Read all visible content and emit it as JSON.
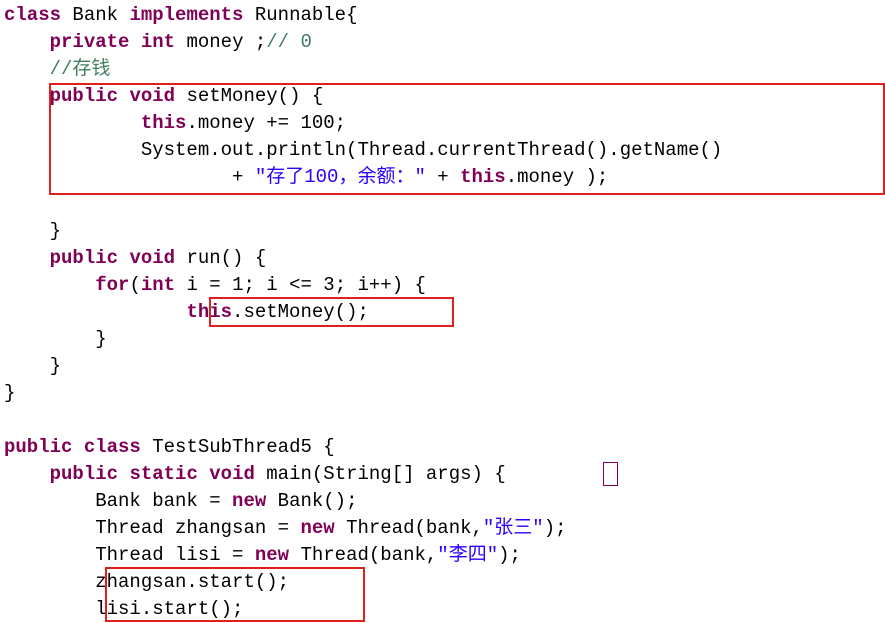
{
  "lines": [
    [
      {
        "t": "class",
        "k": "kw"
      },
      {
        "t": " Bank ",
        "k": "plain"
      },
      {
        "t": "implements",
        "k": "kw"
      },
      {
        "t": " Runnable{",
        "k": "plain"
      }
    ],
    [
      {
        "t": "    ",
        "k": "plain"
      },
      {
        "t": "private",
        "k": "kw"
      },
      {
        "t": " ",
        "k": "plain"
      },
      {
        "t": "int",
        "k": "kw"
      },
      {
        "t": " money ;",
        "k": "plain"
      },
      {
        "t": "// 0",
        "k": "cmt"
      }
    ],
    [
      {
        "t": "    ",
        "k": "plain"
      },
      {
        "t": "//存钱",
        "k": "cmt"
      }
    ],
    [
      {
        "t": "    ",
        "k": "plain"
      },
      {
        "t": "public",
        "k": "kw"
      },
      {
        "t": " ",
        "k": "plain"
      },
      {
        "t": "void",
        "k": "kw"
      },
      {
        "t": " setMoney() {",
        "k": "plain"
      }
    ],
    [
      {
        "t": "            ",
        "k": "plain"
      },
      {
        "t": "this",
        "k": "kw"
      },
      {
        "t": ".money += 100;",
        "k": "plain"
      }
    ],
    [
      {
        "t": "            System.out.println(Thread.currentThread().getName()",
        "k": "plain"
      }
    ],
    [
      {
        "t": "                    + ",
        "k": "plain"
      },
      {
        "t": "\"存了100，余额：\"",
        "k": "str"
      },
      {
        "t": " + ",
        "k": "plain"
      },
      {
        "t": "this",
        "k": "kw"
      },
      {
        "t": ".money );",
        "k": "plain"
      }
    ],
    [],
    [
      {
        "t": "    }",
        "k": "plain"
      }
    ],
    [
      {
        "t": "    ",
        "k": "plain"
      },
      {
        "t": "public",
        "k": "kw"
      },
      {
        "t": " ",
        "k": "plain"
      },
      {
        "t": "void",
        "k": "kw"
      },
      {
        "t": " run() {",
        "k": "plain"
      }
    ],
    [
      {
        "t": "        ",
        "k": "plain"
      },
      {
        "t": "for",
        "k": "kw"
      },
      {
        "t": "(",
        "k": "plain"
      },
      {
        "t": "int",
        "k": "kw"
      },
      {
        "t": " i = 1; i <= 3; i++) {",
        "k": "plain"
      }
    ],
    [
      {
        "t": "                ",
        "k": "plain"
      },
      {
        "t": "this",
        "k": "kw"
      },
      {
        "t": ".setMoney();",
        "k": "plain"
      }
    ],
    [
      {
        "t": "        }",
        "k": "plain"
      }
    ],
    [
      {
        "t": "    }",
        "k": "plain"
      }
    ],
    [
      {
        "t": "}",
        "k": "plain"
      }
    ],
    [],
    [
      {
        "t": "public",
        "k": "kw"
      },
      {
        "t": " ",
        "k": "plain"
      },
      {
        "t": "class",
        "k": "kw"
      },
      {
        "t": " TestSubThread5 {",
        "k": "plain"
      }
    ],
    [
      {
        "t": "    ",
        "k": "plain"
      },
      {
        "t": "public",
        "k": "kw"
      },
      {
        "t": " ",
        "k": "plain"
      },
      {
        "t": "static",
        "k": "kw"
      },
      {
        "t": " ",
        "k": "plain"
      },
      {
        "t": "void",
        "k": "kw"
      },
      {
        "t": " main(String[] args) {",
        "k": "plain"
      }
    ],
    [
      {
        "t": "        Bank bank = ",
        "k": "plain"
      },
      {
        "t": "new",
        "k": "kw"
      },
      {
        "t": " Bank();",
        "k": "plain"
      }
    ],
    [
      {
        "t": "        Thread zhangsan = ",
        "k": "plain"
      },
      {
        "t": "new",
        "k": "kw"
      },
      {
        "t": " Thread(bank,",
        "k": "plain"
      },
      {
        "t": "\"张三\"",
        "k": "str"
      },
      {
        "t": ");",
        "k": "plain"
      }
    ],
    [
      {
        "t": "        Thread lisi = ",
        "k": "plain"
      },
      {
        "t": "new",
        "k": "kw"
      },
      {
        "t": " Thread(bank,",
        "k": "plain"
      },
      {
        "t": "\"李四\"",
        "k": "str"
      },
      {
        "t": ");",
        "k": "plain"
      }
    ],
    [
      {
        "t": "        zhangsan.start();",
        "k": "plain"
      }
    ],
    [
      {
        "t": "        lisi.start();",
        "k": "plain"
      }
    ]
  ],
  "colors": {
    "keyword": "#7f0055",
    "string": "#2a00ff",
    "comment": "#3f7f5f",
    "highlight_box": "#e0201b"
  }
}
